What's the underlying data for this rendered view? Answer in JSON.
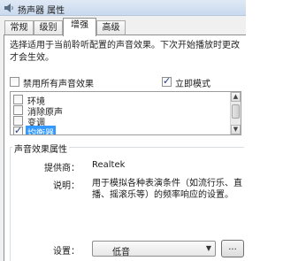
{
  "window": {
    "title": "扬声器 属性"
  },
  "tabs": [
    {
      "label": "常规",
      "active": false
    },
    {
      "label": "级别",
      "active": false
    },
    {
      "label": "增强",
      "active": true
    },
    {
      "label": "高级",
      "active": false
    }
  ],
  "enhancements": {
    "description": "选择适用于当前聆听配置的声音效果。下次开始播放时更改才会生效。",
    "disable_all_label": "禁用所有声音效果",
    "disable_all_checked": false,
    "immediate_mode_label": "立即模式",
    "immediate_mode_checked": true,
    "effects": [
      {
        "label": "环境",
        "checked": false
      },
      {
        "label": "消除原声",
        "checked": false
      },
      {
        "label": "变调",
        "checked": false
      },
      {
        "label": "均衡器",
        "checked": true,
        "selected": true
      }
    ]
  },
  "properties": {
    "group_label": "声音效果属性",
    "provider_key": "提供商：",
    "provider_value": "Realtek",
    "description_key": "说明：",
    "description_value": "用于模拟各种表演条件（如流行乐、直播、摇滚乐等）的频率响应的设置。",
    "settings_key": "设置：",
    "settings_value": "低音",
    "more_button_label": "..."
  }
}
